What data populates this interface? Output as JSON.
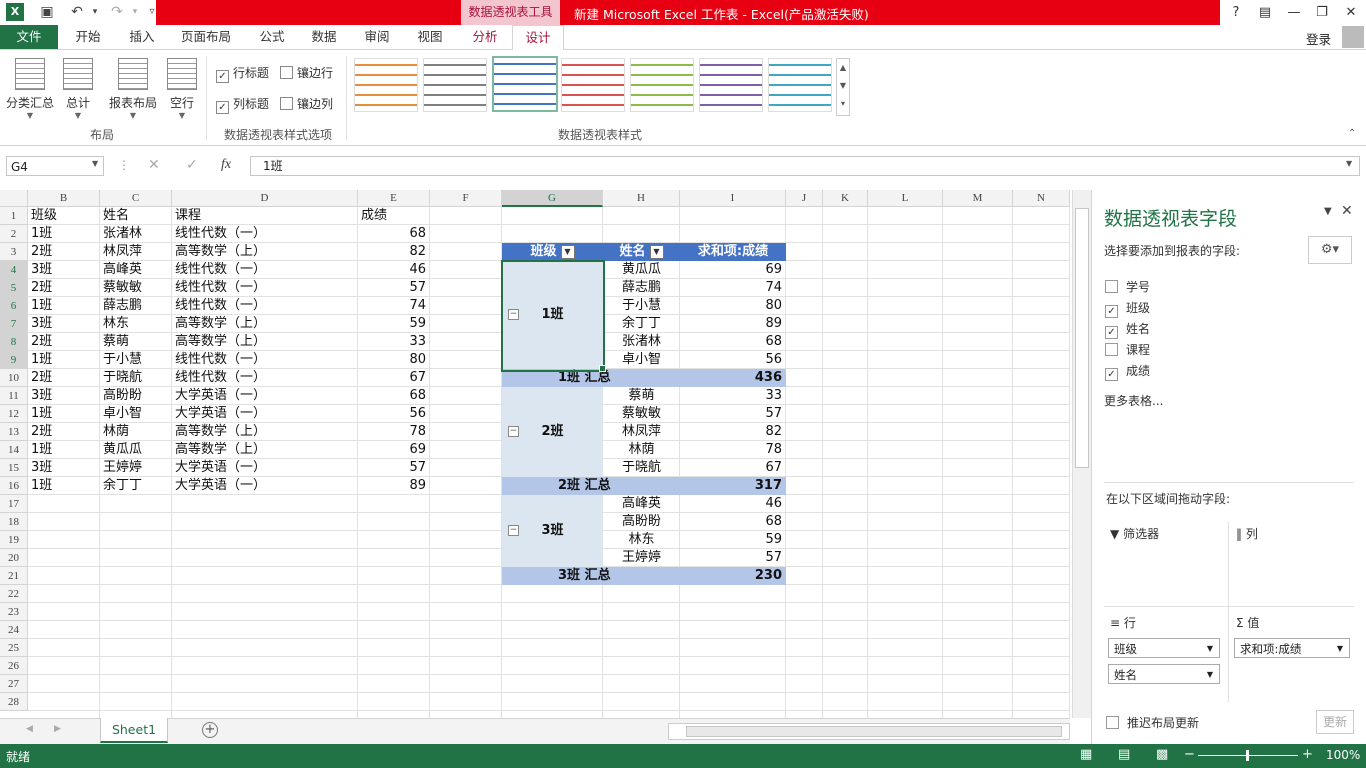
{
  "titlebar": {
    "context_tab": "数据透视表工具",
    "title": "新建 Microsoft Excel 工作表 -  Excel(产品激活失败)",
    "help": "?",
    "login": "登录"
  },
  "tabs": {
    "file": "文件",
    "items": [
      "开始",
      "插入",
      "页面布局",
      "公式",
      "数据",
      "审阅",
      "视图"
    ],
    "ctx_analyze": "分析",
    "ctx_design": "设计"
  },
  "ribbon": {
    "layout_buttons": [
      "分类汇总",
      "总计",
      "报表布局",
      "空行"
    ],
    "layout_group": "布局",
    "options": {
      "row_headers": "行标题",
      "banded_rows": "镶边行",
      "col_headers": "列标题",
      "banded_cols": "镶边列",
      "group": "数据透视表样式选项"
    },
    "styles_group": "数据透视表样式",
    "style_colors": [
      "#e58e3b",
      "#7f7f7f",
      "#4472c4",
      "#d9534f",
      "#8dbb47",
      "#7f5fa7",
      "#3fa6c3"
    ]
  },
  "formula": {
    "namebox": "G4",
    "fx": "fx",
    "value": "1班"
  },
  "columns": [
    "B",
    "C",
    "D",
    "E",
    "F",
    "G",
    "H",
    "I",
    "J",
    "K",
    "L",
    "M",
    "N"
  ],
  "rows": [
    "1",
    "2",
    "3",
    "4",
    "5",
    "6",
    "7",
    "8",
    "9",
    "10",
    "11",
    "12",
    "13",
    "14",
    "15",
    "16",
    "17",
    "18",
    "19",
    "20",
    "21",
    "22",
    "23",
    "24",
    "25",
    "26",
    "27",
    "28"
  ],
  "source": {
    "headers": [
      "班级",
      "姓名",
      "课程",
      "成绩"
    ],
    "data": [
      [
        "1班",
        "张渚林",
        "线性代数（一）",
        "68"
      ],
      [
        "2班",
        "林凤萍",
        "高等数学（上）",
        "82"
      ],
      [
        "3班",
        "高峰英",
        "线性代数（一）",
        "46"
      ],
      [
        "2班",
        "蔡敏敏",
        "线性代数（一）",
        "57"
      ],
      [
        "1班",
        "薛志鹏",
        "线性代数（一）",
        "74"
      ],
      [
        "3班",
        "林东",
        "高等数学（上）",
        "59"
      ],
      [
        "2班",
        "蔡萌",
        "高等数学（上）",
        "33"
      ],
      [
        "1班",
        "于小慧",
        "线性代数（一）",
        "80"
      ],
      [
        "2班",
        "于晓航",
        "线性代数（一）",
        "67"
      ],
      [
        "3班",
        "高盼盼",
        "大学英语（一）",
        "68"
      ],
      [
        "1班",
        "卓小智",
        "大学英语（一）",
        "56"
      ],
      [
        "2班",
        "林荫",
        "高等数学（上）",
        "78"
      ],
      [
        "1班",
        "黄瓜瓜",
        "高等数学（上）",
        "69"
      ],
      [
        "3班",
        "王婷婷",
        "大学英语（一）",
        "57"
      ],
      [
        "1班",
        "余丁丁",
        "大学英语（一）",
        "89"
      ]
    ]
  },
  "pivot": {
    "headers": [
      "班级",
      "姓名",
      "求和项:成绩"
    ],
    "groups": [
      {
        "name": "1班",
        "subtotal_label": "1班 汇总",
        "subtotal": "436",
        "rows": [
          [
            "黄瓜瓜",
            "69"
          ],
          [
            "薛志鹏",
            "74"
          ],
          [
            "于小慧",
            "80"
          ],
          [
            "余丁丁",
            "89"
          ],
          [
            "张渚林",
            "68"
          ],
          [
            "卓小智",
            "56"
          ]
        ]
      },
      {
        "name": "2班",
        "subtotal_label": "2班 汇总",
        "subtotal": "317",
        "rows": [
          [
            "蔡萌",
            "33"
          ],
          [
            "蔡敏敏",
            "57"
          ],
          [
            "林凤萍",
            "82"
          ],
          [
            "林荫",
            "78"
          ],
          [
            "于晓航",
            "67"
          ]
        ]
      },
      {
        "name": "3班",
        "subtotal_label": "3班 汇总",
        "subtotal": "230",
        "rows": [
          [
            "高峰英",
            "46"
          ],
          [
            "高盼盼",
            "68"
          ],
          [
            "林东",
            "59"
          ],
          [
            "王婷婷",
            "57"
          ]
        ]
      }
    ]
  },
  "pane": {
    "title": "数据透视表字段",
    "subtitle": "选择要添加到报表的字段:",
    "fields": [
      {
        "label": "学号",
        "checked": false
      },
      {
        "label": "班级",
        "checked": true
      },
      {
        "label": "姓名",
        "checked": true
      },
      {
        "label": "课程",
        "checked": false
      },
      {
        "label": "成绩",
        "checked": true
      }
    ],
    "more_tables": "更多表格...",
    "drag_label": "在以下区域间拖动字段:",
    "filter": "筛选器",
    "columns": "列",
    "rows": "行",
    "values": "值",
    "row_fields": [
      "班级",
      "姓名"
    ],
    "value_fields": [
      "求和项:成绩"
    ],
    "defer": "推迟布局更新",
    "update": "更新"
  },
  "sheet": {
    "tab": "Sheet1",
    "add": "+"
  },
  "status": {
    "ready": "就绪",
    "zoom": "100%"
  }
}
